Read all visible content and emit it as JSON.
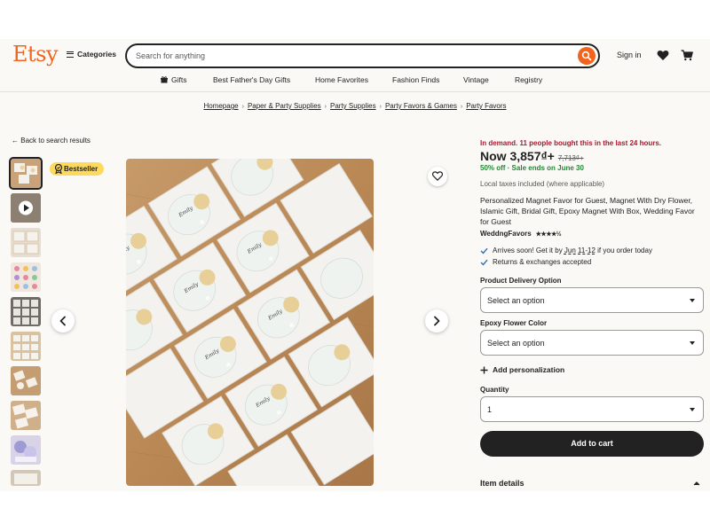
{
  "header": {
    "logo": "Etsy",
    "categories_label": "Categories",
    "search_placeholder": "Search for anything",
    "signin_label": "Sign in"
  },
  "nav": {
    "items": [
      "Gifts",
      "Best Father's Day Gifts",
      "Home Favorites",
      "Fashion Finds",
      "Vintage",
      "Registry"
    ]
  },
  "breadcrumb": [
    "Homepage",
    "Paper & Party Supplies",
    "Party Supplies",
    "Party Favors & Games",
    "Party Favors"
  ],
  "back_link": "Back to search results",
  "badge": "Bestseller",
  "product": {
    "demand": "In demand. 11 people bought this in the last 24 hours.",
    "price_now": "Now 3,857₫+",
    "price_original": "7,713₫+",
    "discount": "50% off · Sale ends on June 30",
    "taxes": "Local taxes included (where applicable)",
    "title": "Personalized Magnet Favor for Guest, Magnet With Dry Flower, Islamic Gift, Bridal Gift, Epoxy Magnet With Box, Wedding Favor for Guest",
    "shop": "WeddngFavors",
    "rating_stars": "★★★★½",
    "rating_value": 4.5,
    "arrives_prefix": "Arrives soon! Get it by ",
    "arrives_date": "Jun 11-12",
    "arrives_suffix": " if you order today",
    "returns": "Returns & exchanges accepted"
  },
  "options": {
    "delivery_label": "Product Delivery Option",
    "delivery_value": "Select an option",
    "flower_label": "Epoxy Flower Color",
    "flower_value": "Select an option",
    "personalization": "Add personalization",
    "quantity_label": "Quantity",
    "quantity_value": "1",
    "cart_button": "Add to cart",
    "item_details": "Item details"
  },
  "colors": {
    "brand": "#f1641e",
    "demand": "#a61a2e",
    "sale": "#258635",
    "badge": "#fdd95c",
    "button": "#222222"
  }
}
